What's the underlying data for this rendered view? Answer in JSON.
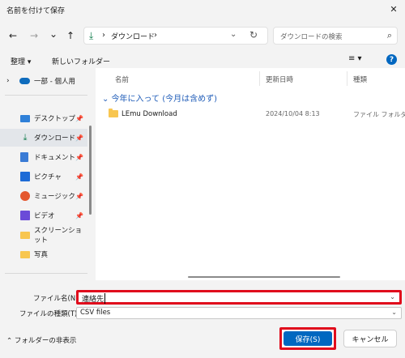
{
  "window": {
    "title": "名前を付けて保存",
    "close_glyph": "✕"
  },
  "nav": {
    "back": "←",
    "forward": "→",
    "recent": "⌄",
    "up": "↑"
  },
  "address": {
    "crumb": "ダウンロード",
    "separator": "›"
  },
  "search": {
    "placeholder": "ダウンロードの検索"
  },
  "toolbar": {
    "organize": "整理 ▾",
    "new_folder": "新しいフォルダー",
    "view": "≡ ▾",
    "help": "?"
  },
  "sidebar": {
    "top_item": {
      "label": "一部 - 個人用",
      "expand": "›"
    },
    "items": [
      {
        "label": "デスクトップ",
        "icon": "desktop-icon",
        "pinned": true
      },
      {
        "label": "ダウンロード",
        "icon": "download-icon",
        "pinned": true,
        "selected": true
      },
      {
        "label": "ドキュメント",
        "icon": "document-icon",
        "pinned": true
      },
      {
        "label": "ピクチャ",
        "icon": "picture-icon",
        "pinned": true
      },
      {
        "label": "ミュージック",
        "icon": "music-icon",
        "pinned": true
      },
      {
        "label": "ビデオ",
        "icon": "video-icon",
        "pinned": true
      },
      {
        "label": "スクリーンショット",
        "icon": "folder-icon",
        "pinned": false
      },
      {
        "label": "写真",
        "icon": "folder-icon",
        "pinned": false
      }
    ]
  },
  "columns": {
    "name": "名前",
    "date": "更新日時",
    "type": "種類"
  },
  "group": {
    "label": "⌄ 今年に入って (今月は含めず)"
  },
  "files": [
    {
      "name": "LEmu Download",
      "date": "2024/10/04 8:13",
      "type": "ファイル フォルダー"
    }
  ],
  "form": {
    "filename_label": "ファイル名(N):",
    "filename_value": "連絡先",
    "filetype_label": "ファイルの種類(T):",
    "filetype_value": "CSV files"
  },
  "footer": {
    "hide_folders": "⌃ フォルダーの非表示",
    "save": "保存(S)",
    "cancel": "キャンセル"
  },
  "colors": {
    "accent": "#0067c0",
    "highlight": "#e00b1c",
    "folder": "#f8c650"
  }
}
